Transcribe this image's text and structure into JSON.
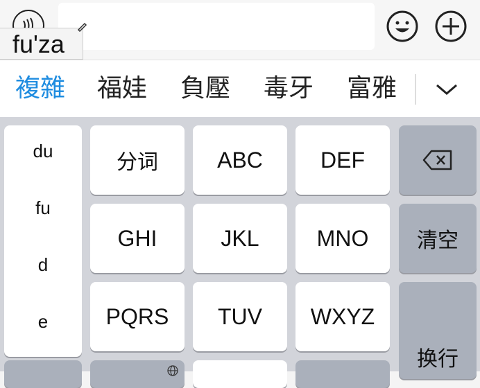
{
  "input_bar": {
    "composing_text": "fu'za"
  },
  "icons": {
    "voice": "voice-icon",
    "emoji": "smiley-icon",
    "plus": "plus-icon",
    "expand": "chevron-down-icon",
    "backspace": "backspace-icon",
    "globe": "globe-icon",
    "pencil": "pencil-icon"
  },
  "candidates": [
    "複雜",
    "福娃",
    "負壓",
    "毒牙",
    "富雅"
  ],
  "pinyin_options": [
    "du",
    "fu",
    "d",
    "e"
  ],
  "keys": {
    "row1": [
      "分词",
      "ABC",
      "DEF"
    ],
    "row2": [
      "GHI",
      "JKL",
      "MNO"
    ],
    "row3": [
      "PQRS",
      "TUV",
      "WXYZ"
    ],
    "clear_label": "清空",
    "enter_label": "换行"
  },
  "colors": {
    "accent": "#1e8ce0",
    "keyboard_bg": "#d2d4da",
    "function_key": "#aab0bb"
  }
}
